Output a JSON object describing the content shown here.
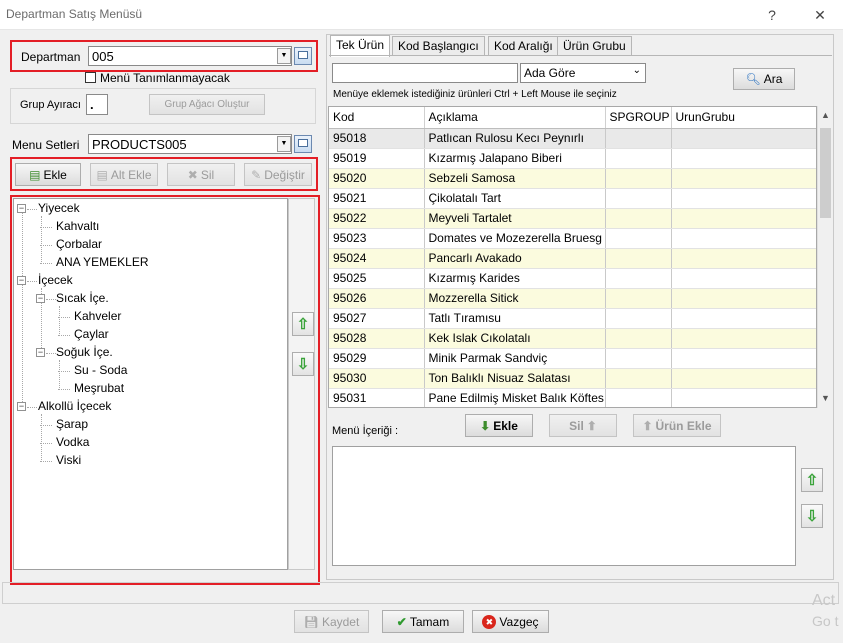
{
  "window": {
    "title": "Departman Satış Menüsü",
    "help_glyph": "?",
    "close_glyph": "✕"
  },
  "left": {
    "department_label": "Departman",
    "department_value": "005",
    "no_menu_label": "Menü Tanımlanmayacak",
    "group_separator_label": "Grup Ayıracı",
    "group_separator_value": ".",
    "group_tree_button": "Grup Ağacı Oluştur",
    "menu_sets_label": "Menu Setleri",
    "menu_sets_value": "PRODUCTS005",
    "buttons": {
      "add": "Ekle",
      "add_sub": "Alt Ekle",
      "delete": "Sil",
      "change": "Değiştir"
    },
    "tree": [
      {
        "label": "Yiyecek",
        "level": 0,
        "expander": "−"
      },
      {
        "label": "Kahvaltı",
        "level": 1
      },
      {
        "label": "Çorbalar",
        "level": 1
      },
      {
        "label": "ANA YEMEKLER",
        "level": 1
      },
      {
        "label": "İçecek",
        "level": 0,
        "expander": "−"
      },
      {
        "label": "Sıcak İçe.",
        "level": 1,
        "expander": "−"
      },
      {
        "label": "Kahveler",
        "level": 2
      },
      {
        "label": "Çaylar",
        "level": 2
      },
      {
        "label": "Soğuk İçe.",
        "level": 1,
        "expander": "−"
      },
      {
        "label": "Su - Soda",
        "level": 2
      },
      {
        "label": "Meşrubat",
        "level": 2
      },
      {
        "label": "Alkollü İçecek",
        "level": 0,
        "expander": "−"
      },
      {
        "label": "Şarap",
        "level": 1
      },
      {
        "label": "Vodka",
        "level": 1
      },
      {
        "label": "Viski",
        "level": 1
      }
    ]
  },
  "right": {
    "tabs": [
      "Tek Ürün",
      "Kod Başlangıcı",
      "Kod Aralığı",
      "Ürün Grubu"
    ],
    "search_value": "",
    "search_mode": "Ada Göre",
    "search_button": "Ara",
    "hint": "Menüye eklemek istediğiniz ürünleri Ctrl + Left Mouse ile seçiniz",
    "columns": [
      "Kod",
      "Açıklama",
      "SPGROUP",
      "UrunGrubu"
    ],
    "rows": [
      {
        "kod": "95018",
        "aciklama": "Patlıcan Rulosu Kecı Peynırlı",
        "spgroup": "",
        "urungrubu": ""
      },
      {
        "kod": "95019",
        "aciklama": "Kızarmış Jalapano Biberi",
        "spgroup": "",
        "urungrubu": ""
      },
      {
        "kod": "95020",
        "aciklama": "Sebzeli Samosa",
        "spgroup": "",
        "urungrubu": ""
      },
      {
        "kod": "95021",
        "aciklama": "Çikolatalı Tart",
        "spgroup": "",
        "urungrubu": ""
      },
      {
        "kod": "95022",
        "aciklama": "Meyveli Tartalet",
        "spgroup": "",
        "urungrubu": ""
      },
      {
        "kod": "95023",
        "aciklama": "Domates ve Mozezerella Bruesg",
        "spgroup": "",
        "urungrubu": ""
      },
      {
        "kod": "95024",
        "aciklama": "Pancarlı Avakado",
        "spgroup": "",
        "urungrubu": ""
      },
      {
        "kod": "95025",
        "aciklama": "Kızarmış Karides",
        "spgroup": "",
        "urungrubu": ""
      },
      {
        "kod": "95026",
        "aciklama": "Mozzerella Sitick",
        "spgroup": "",
        "urungrubu": ""
      },
      {
        "kod": "95027",
        "aciklama": "Tatlı Tıramısu",
        "spgroup": "",
        "urungrubu": ""
      },
      {
        "kod": "95028",
        "aciklama": "Kek Islak Cıkolatalı",
        "spgroup": "",
        "urungrubu": ""
      },
      {
        "kod": "95029",
        "aciklama": "Minik Parmak Sandviç",
        "spgroup": "",
        "urungrubu": ""
      },
      {
        "kod": "95030",
        "aciklama": "Ton Balıklı Nisuaz Salatası",
        "spgroup": "",
        "urungrubu": ""
      },
      {
        "kod": "95031",
        "aciklama": "Pane Edilmiş Misket Balık Köftes",
        "spgroup": "",
        "urungrubu": ""
      }
    ],
    "menu_content_label": "Menü İçeriği :",
    "buttons": {
      "add": "Ekle",
      "delete": "Sil",
      "add_product": "Ürün Ekle"
    }
  },
  "footer": {
    "save": "Kaydet",
    "ok": "Tamam",
    "cancel": "Vazgeç",
    "watermark_line1": "Act",
    "watermark_line2": "Go t"
  }
}
